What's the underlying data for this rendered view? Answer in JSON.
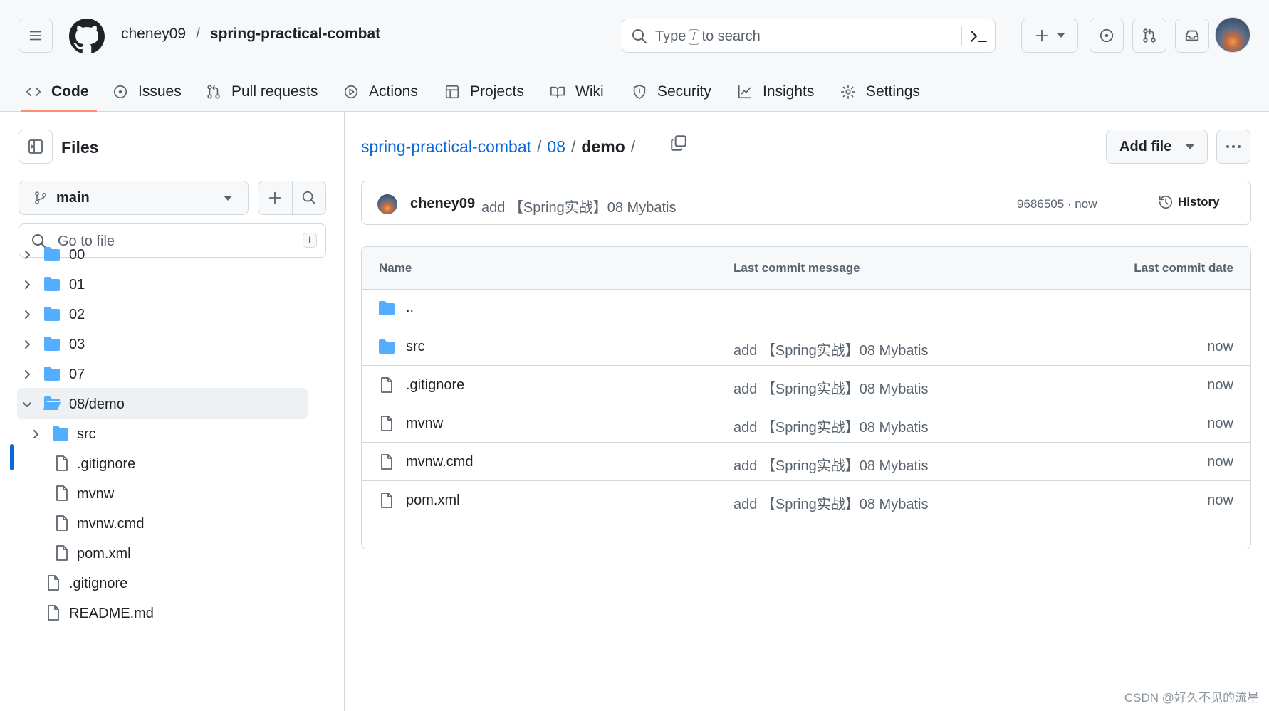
{
  "header": {
    "owner": "cheney09",
    "separator": "/",
    "repo": "spring-practical-combat",
    "search": {
      "before": "Type",
      "key": "/",
      "after": "to search"
    }
  },
  "nav": {
    "tabs": [
      {
        "label": "Code",
        "icon": "code-icon",
        "active": true
      },
      {
        "label": "Issues",
        "icon": "issue-icon"
      },
      {
        "label": "Pull requests",
        "icon": "pull-request-icon"
      },
      {
        "label": "Actions",
        "icon": "play-icon"
      },
      {
        "label": "Projects",
        "icon": "table-icon"
      },
      {
        "label": "Wiki",
        "icon": "book-icon"
      },
      {
        "label": "Security",
        "icon": "shield-icon"
      },
      {
        "label": "Insights",
        "icon": "graph-icon"
      },
      {
        "label": "Settings",
        "icon": "gear-icon"
      }
    ]
  },
  "sidebar": {
    "title": "Files",
    "branch": "main",
    "goto_placeholder": "Go to file",
    "goto_key": "t",
    "tree": [
      {
        "label": "00",
        "type": "folder",
        "expanded": false
      },
      {
        "label": "01",
        "type": "folder",
        "expanded": false
      },
      {
        "label": "02",
        "type": "folder",
        "expanded": false
      },
      {
        "label": "03",
        "type": "folder",
        "expanded": false
      },
      {
        "label": "07",
        "type": "folder",
        "expanded": false
      },
      {
        "label": "08/demo",
        "type": "folder",
        "expanded": true,
        "selected": true
      },
      {
        "label": "src",
        "type": "folder",
        "expanded": false
      },
      {
        "label": ".gitignore",
        "type": "file"
      },
      {
        "label": "mvnw",
        "type": "file"
      },
      {
        "label": "mvnw.cmd",
        "type": "file"
      },
      {
        "label": "pom.xml",
        "type": "file"
      },
      {
        "label": ".gitignore",
        "type": "file"
      },
      {
        "label": "README.md",
        "type": "file"
      }
    ]
  },
  "main": {
    "breadcrumb": {
      "repo": "spring-practical-combat",
      "sep1": "/",
      "dir": "08",
      "sep2": "/",
      "current": "demo",
      "sep3": "/"
    },
    "add_file_label": "Add file",
    "commit": {
      "author": "cheney09",
      "message": "add 【Spring实战】08 Mybatis",
      "sha_time": "9686505 · now",
      "history_label": "History"
    },
    "table": {
      "headers": {
        "name": "Name",
        "message": "Last commit message",
        "date": "Last commit date"
      },
      "rows": [
        {
          "name": "..",
          "type": "folder",
          "message": "",
          "date": ""
        },
        {
          "name": "src",
          "type": "folder",
          "message": "add 【Spring实战】08 Mybatis",
          "date": "now"
        },
        {
          "name": ".gitignore",
          "type": "file",
          "message": "add 【Spring实战】08 Mybatis",
          "date": "now"
        },
        {
          "name": "mvnw",
          "type": "file",
          "message": "add 【Spring实战】08 Mybatis",
          "date": "now"
        },
        {
          "name": "mvnw.cmd",
          "type": "file",
          "message": "add 【Spring实战】08 Mybatis",
          "date": "now"
        },
        {
          "name": "pom.xml",
          "type": "file",
          "message": "add 【Spring实战】08 Mybatis",
          "date": "now"
        }
      ]
    }
  },
  "watermark": "CSDN @好久不见的流星",
  "colors": {
    "accent": "#0969da",
    "tab_underline": "#fd8c73",
    "folder": "#54aeff"
  }
}
